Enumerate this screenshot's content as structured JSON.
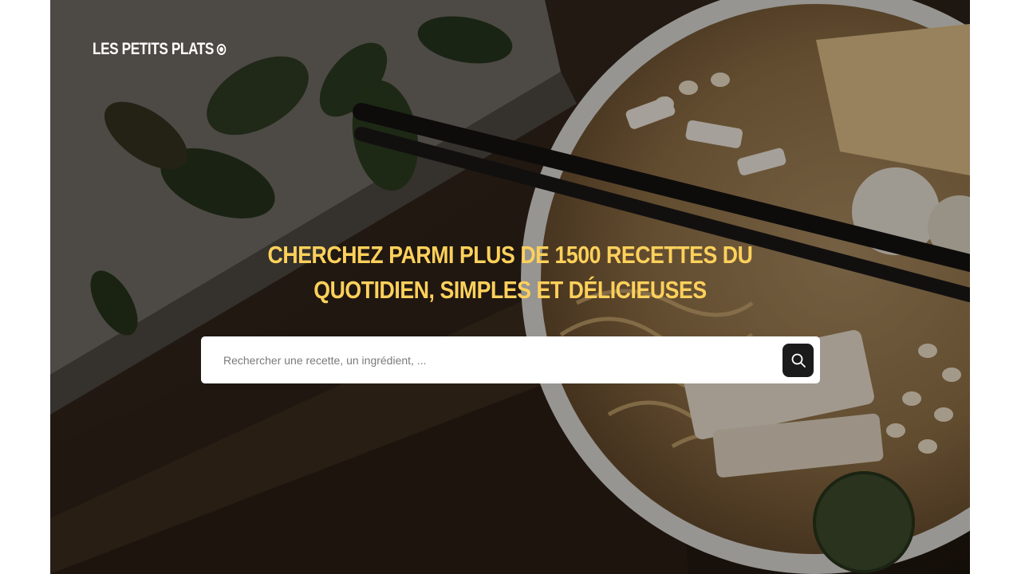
{
  "brand": {
    "name": "LES PETITS PLATS"
  },
  "hero": {
    "headline_line1": "CHERCHEZ PARMI PLUS DE 1500 RECETTES DU",
    "headline_line2": "QUOTIDIEN, SIMPLES ET DÉLICIEUSES"
  },
  "search": {
    "placeholder": "Rechercher une recette, un ingrédient, ...",
    "value": "",
    "button_icon": "search-icon"
  },
  "colors": {
    "headline": "#ffd15b",
    "search_button": "#1b1b1b",
    "logo": "#ffffff"
  }
}
